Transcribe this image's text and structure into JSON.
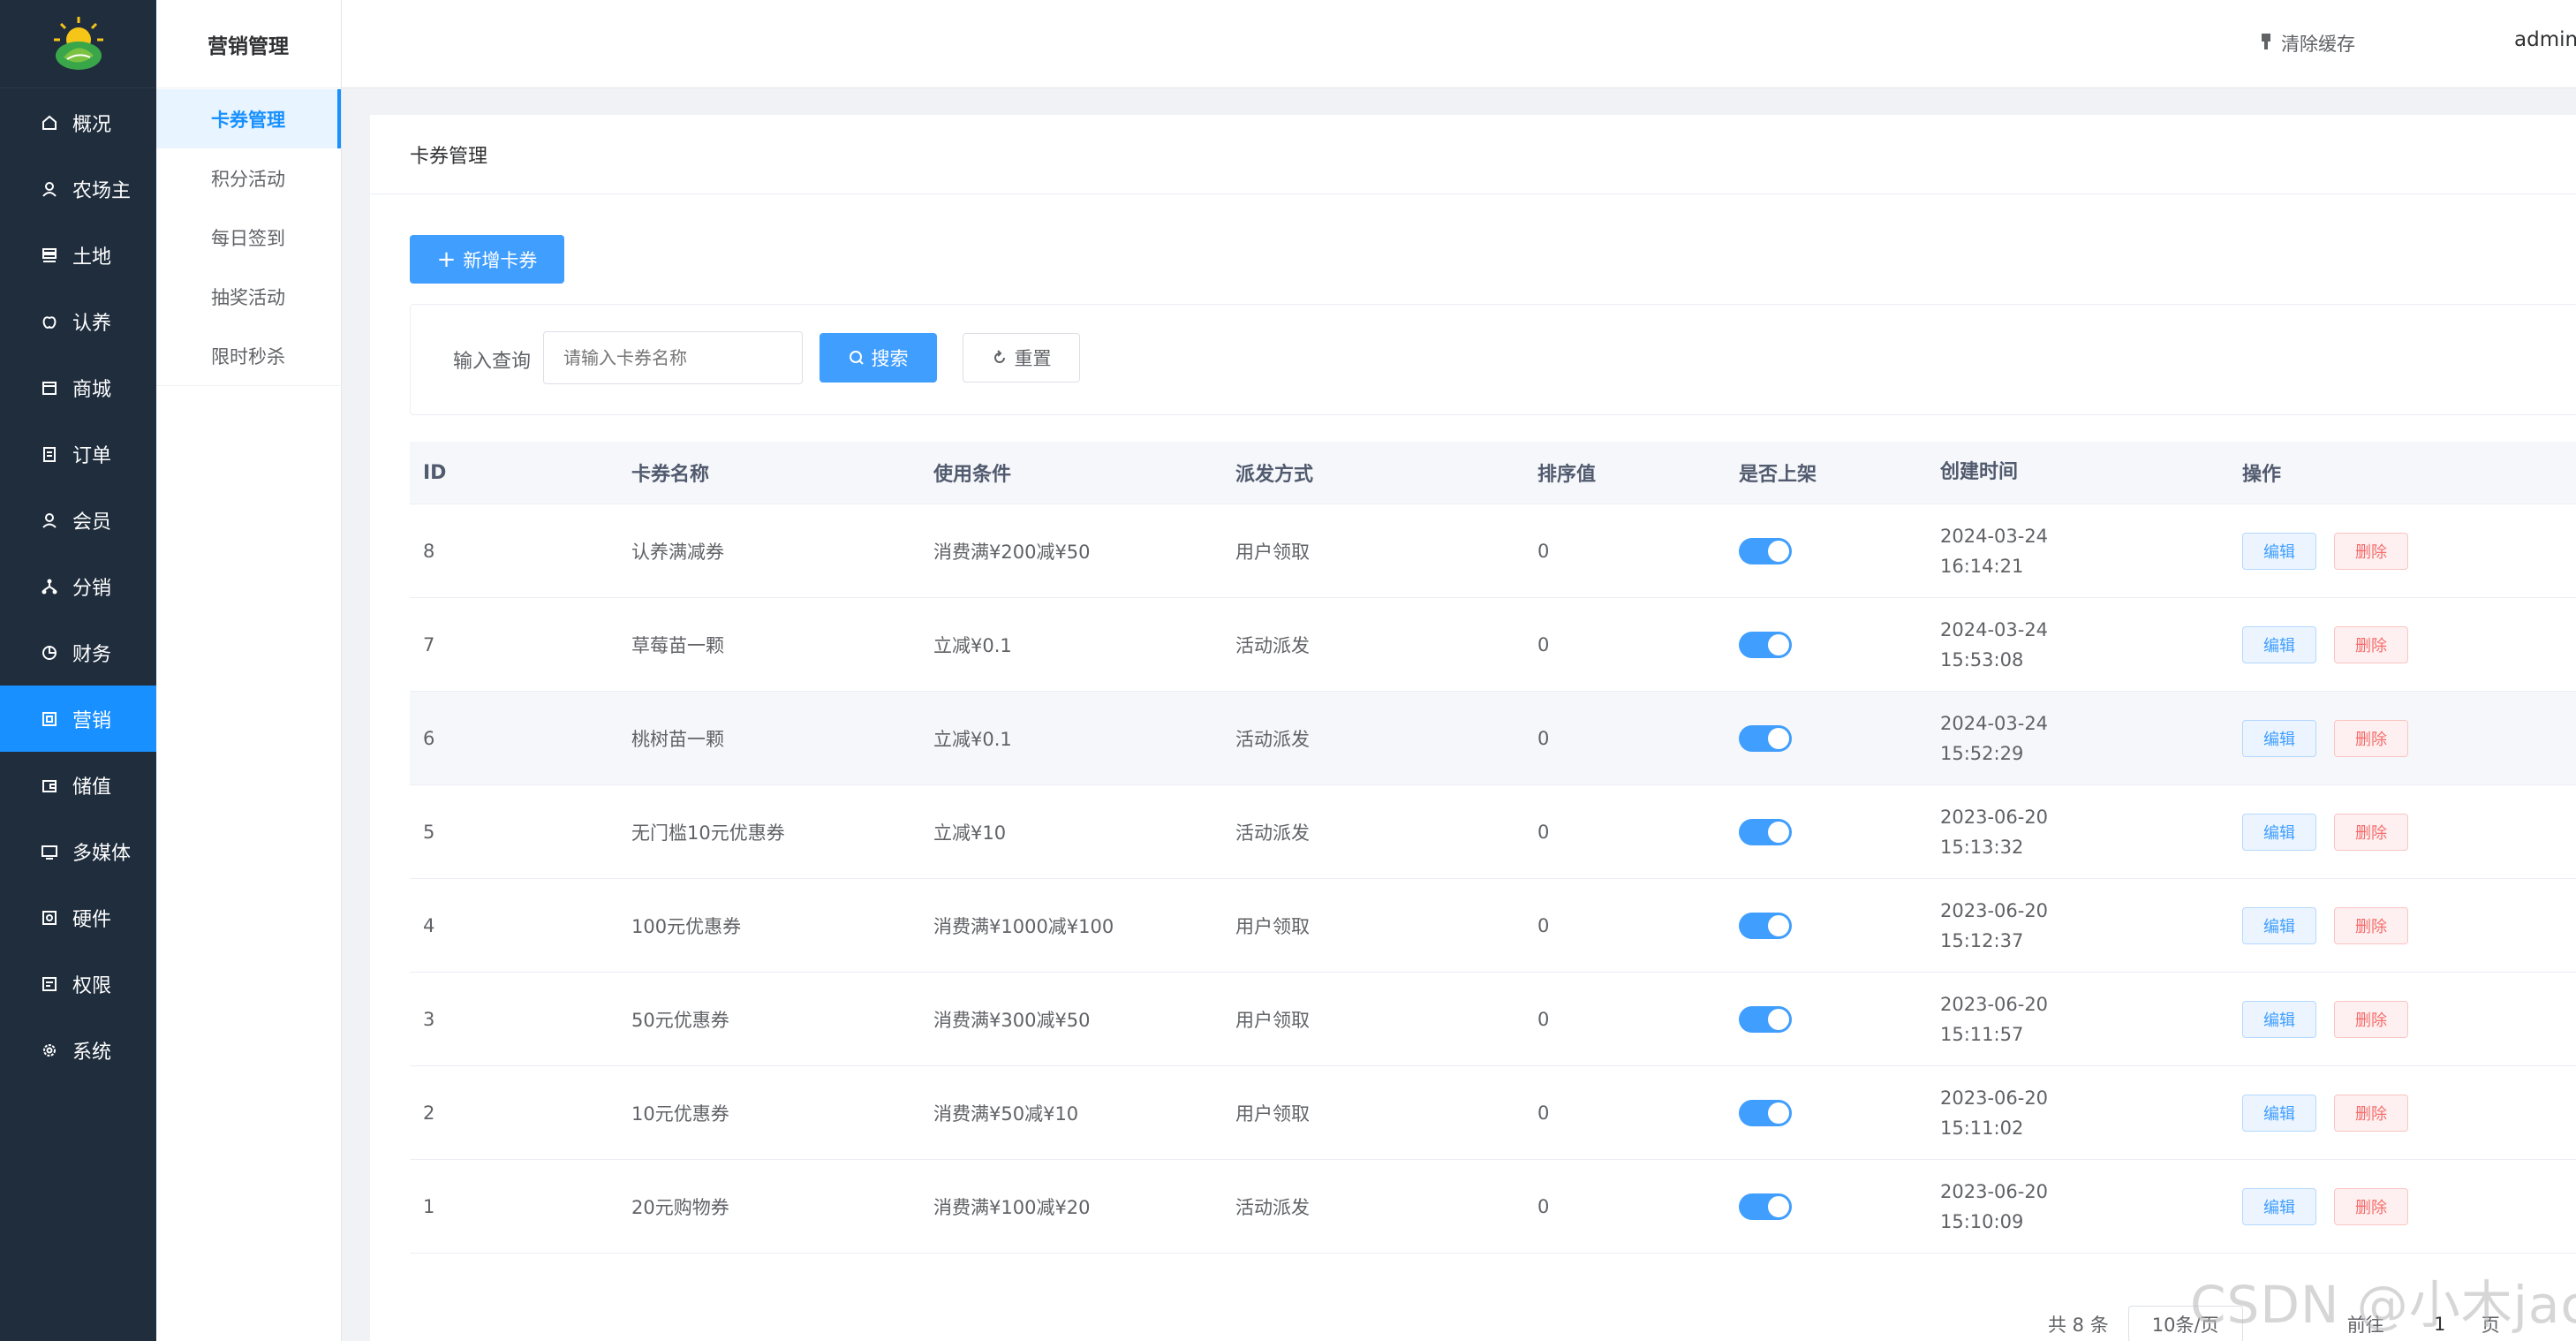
{
  "sidebar": {
    "items": [
      {
        "label": "概况",
        "icon": "home-icon"
      },
      {
        "label": "农场主",
        "icon": "user-icon"
      },
      {
        "label": "土地",
        "icon": "land-icon"
      },
      {
        "label": "认养",
        "icon": "apple-icon"
      },
      {
        "label": "商城",
        "icon": "shop-icon"
      },
      {
        "label": "订单",
        "icon": "order-icon"
      },
      {
        "label": "会员",
        "icon": "member-icon"
      },
      {
        "label": "分销",
        "icon": "distribution-icon"
      },
      {
        "label": "财务",
        "icon": "finance-icon"
      },
      {
        "label": "营销",
        "icon": "marketing-icon",
        "active": true
      },
      {
        "label": "储值",
        "icon": "wallet-icon"
      },
      {
        "label": "多媒体",
        "icon": "media-icon"
      },
      {
        "label": "硬件",
        "icon": "hardware-icon"
      },
      {
        "label": "权限",
        "icon": "permission-icon"
      },
      {
        "label": "系统",
        "icon": "gear-icon"
      }
    ]
  },
  "subnav": {
    "title": "营销管理",
    "items": [
      {
        "label": "卡券管理",
        "active": true
      },
      {
        "label": "积分活动"
      },
      {
        "label": "每日签到"
      },
      {
        "label": "抽奖活动"
      },
      {
        "label": "限时秒杀"
      }
    ]
  },
  "header": {
    "clear_cache": "清除缓存",
    "user": "admin"
  },
  "main": {
    "title": "卡券管理",
    "add_button": "新增卡券",
    "search": {
      "label": "输入查询",
      "placeholder": "请输入卡券名称",
      "search_button": "搜索",
      "reset_button": "重置"
    },
    "table": {
      "columns": [
        "ID",
        "卡券名称",
        "使用条件",
        "派发方式",
        "排序值",
        "是否上架",
        "创建时间",
        "操作"
      ],
      "rows": [
        {
          "id": "8",
          "name": "认养满减券",
          "cond": "消费满¥200减¥50",
          "way": "用户领取",
          "sort": "0",
          "on": true,
          "date": "2024-03-24",
          "time": "16:14:21"
        },
        {
          "id": "7",
          "name": "草莓苗一颗",
          "cond": "立减¥0.1",
          "way": "活动派发",
          "sort": "0",
          "on": true,
          "date": "2024-03-24",
          "time": "15:53:08"
        },
        {
          "id": "6",
          "name": "桃树苗一颗",
          "cond": "立减¥0.1",
          "way": "活动派发",
          "sort": "0",
          "on": true,
          "date": "2024-03-24",
          "time": "15:52:29"
        },
        {
          "id": "5",
          "name": "无门槛10元优惠券",
          "cond": "立减¥10",
          "way": "活动派发",
          "sort": "0",
          "on": true,
          "date": "2023-06-20",
          "time": "15:13:32"
        },
        {
          "id": "4",
          "name": "100元优惠券",
          "cond": "消费满¥1000减¥100",
          "way": "用户领取",
          "sort": "0",
          "on": true,
          "date": "2023-06-20",
          "time": "15:12:37"
        },
        {
          "id": "3",
          "name": "50元优惠券",
          "cond": "消费满¥300减¥50",
          "way": "用户领取",
          "sort": "0",
          "on": true,
          "date": "2023-06-20",
          "time": "15:11:57"
        },
        {
          "id": "2",
          "name": "10元优惠券",
          "cond": "消费满¥50减¥10",
          "way": "用户领取",
          "sort": "0",
          "on": true,
          "date": "2023-06-20",
          "time": "15:11:02"
        },
        {
          "id": "1",
          "name": "20元购物券",
          "cond": "消费满¥100减¥20",
          "way": "活动派发",
          "sort": "0",
          "on": true,
          "date": "2023-06-20",
          "time": "15:10:09"
        }
      ],
      "edit_label": "编辑",
      "delete_label": "删除"
    },
    "pagination": {
      "total": "共 8 条",
      "page_size": "10条/页",
      "goto_label": "前往",
      "page": "1",
      "page_suffix": "页"
    }
  },
  "watermark": "CSDN @小木jac",
  "colors": {
    "sidebar_bg": "#1f2d3d",
    "accent": "#409eff",
    "active_nav": "#1890ff",
    "danger": "#f56c6c"
  }
}
